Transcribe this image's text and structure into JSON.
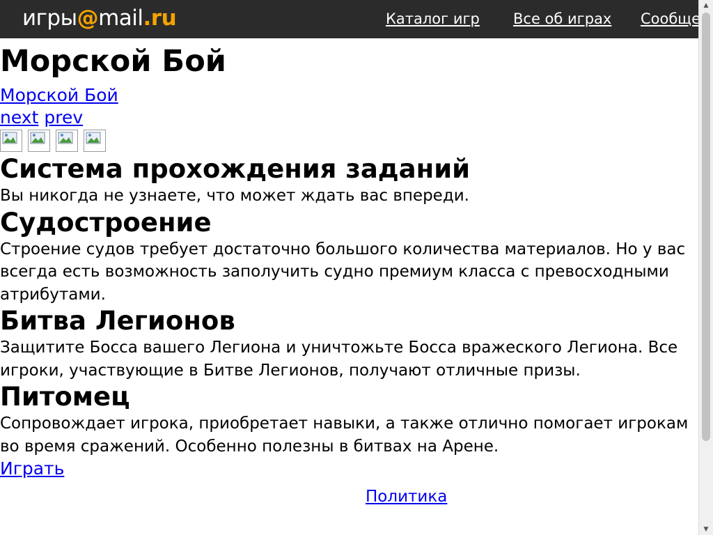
{
  "header": {
    "logo_word": "игры",
    "logo_at": "@",
    "logo_mail": "mail",
    "logo_ru": ".ru",
    "nav": [
      {
        "label": "Каталог игр"
      },
      {
        "label": "Все об играх"
      },
      {
        "label": "Сообщества"
      }
    ]
  },
  "page": {
    "title": "Морской Бой",
    "game_link": "Морской Бой",
    "next_label": "next",
    "prev_label": "prev",
    "thumbnail_count": 4
  },
  "sections": [
    {
      "heading": "Система прохождения заданий",
      "text": "Вы никогда не узнаете, что может ждать вас впереди."
    },
    {
      "heading": "Судостроение",
      "text": "Строение судов требует достаточно большого количества материалов. Но у вас всегда есть возможность заполучить судно премиум класса с превосходными атрибутами."
    },
    {
      "heading": "Битва Легионов",
      "text": "Защитите Босса вашего Легиона и уничтожьте Босса вражеского Легиона. Все игроки, участвующие в Битве Легионов, получают отличные призы."
    },
    {
      "heading": "Питомец",
      "text": "Сопровождает игрока, приобретает навыки, а также отлично помогает игрокам во время сражений. Особенно полезны в битвах на Арене."
    }
  ],
  "play_label": "Играть",
  "footer": {
    "policy_label": "Политика"
  },
  "colors": {
    "topbar": "#2b2b2b",
    "logo_accent": "#f5a300",
    "link": "#0000ee"
  }
}
